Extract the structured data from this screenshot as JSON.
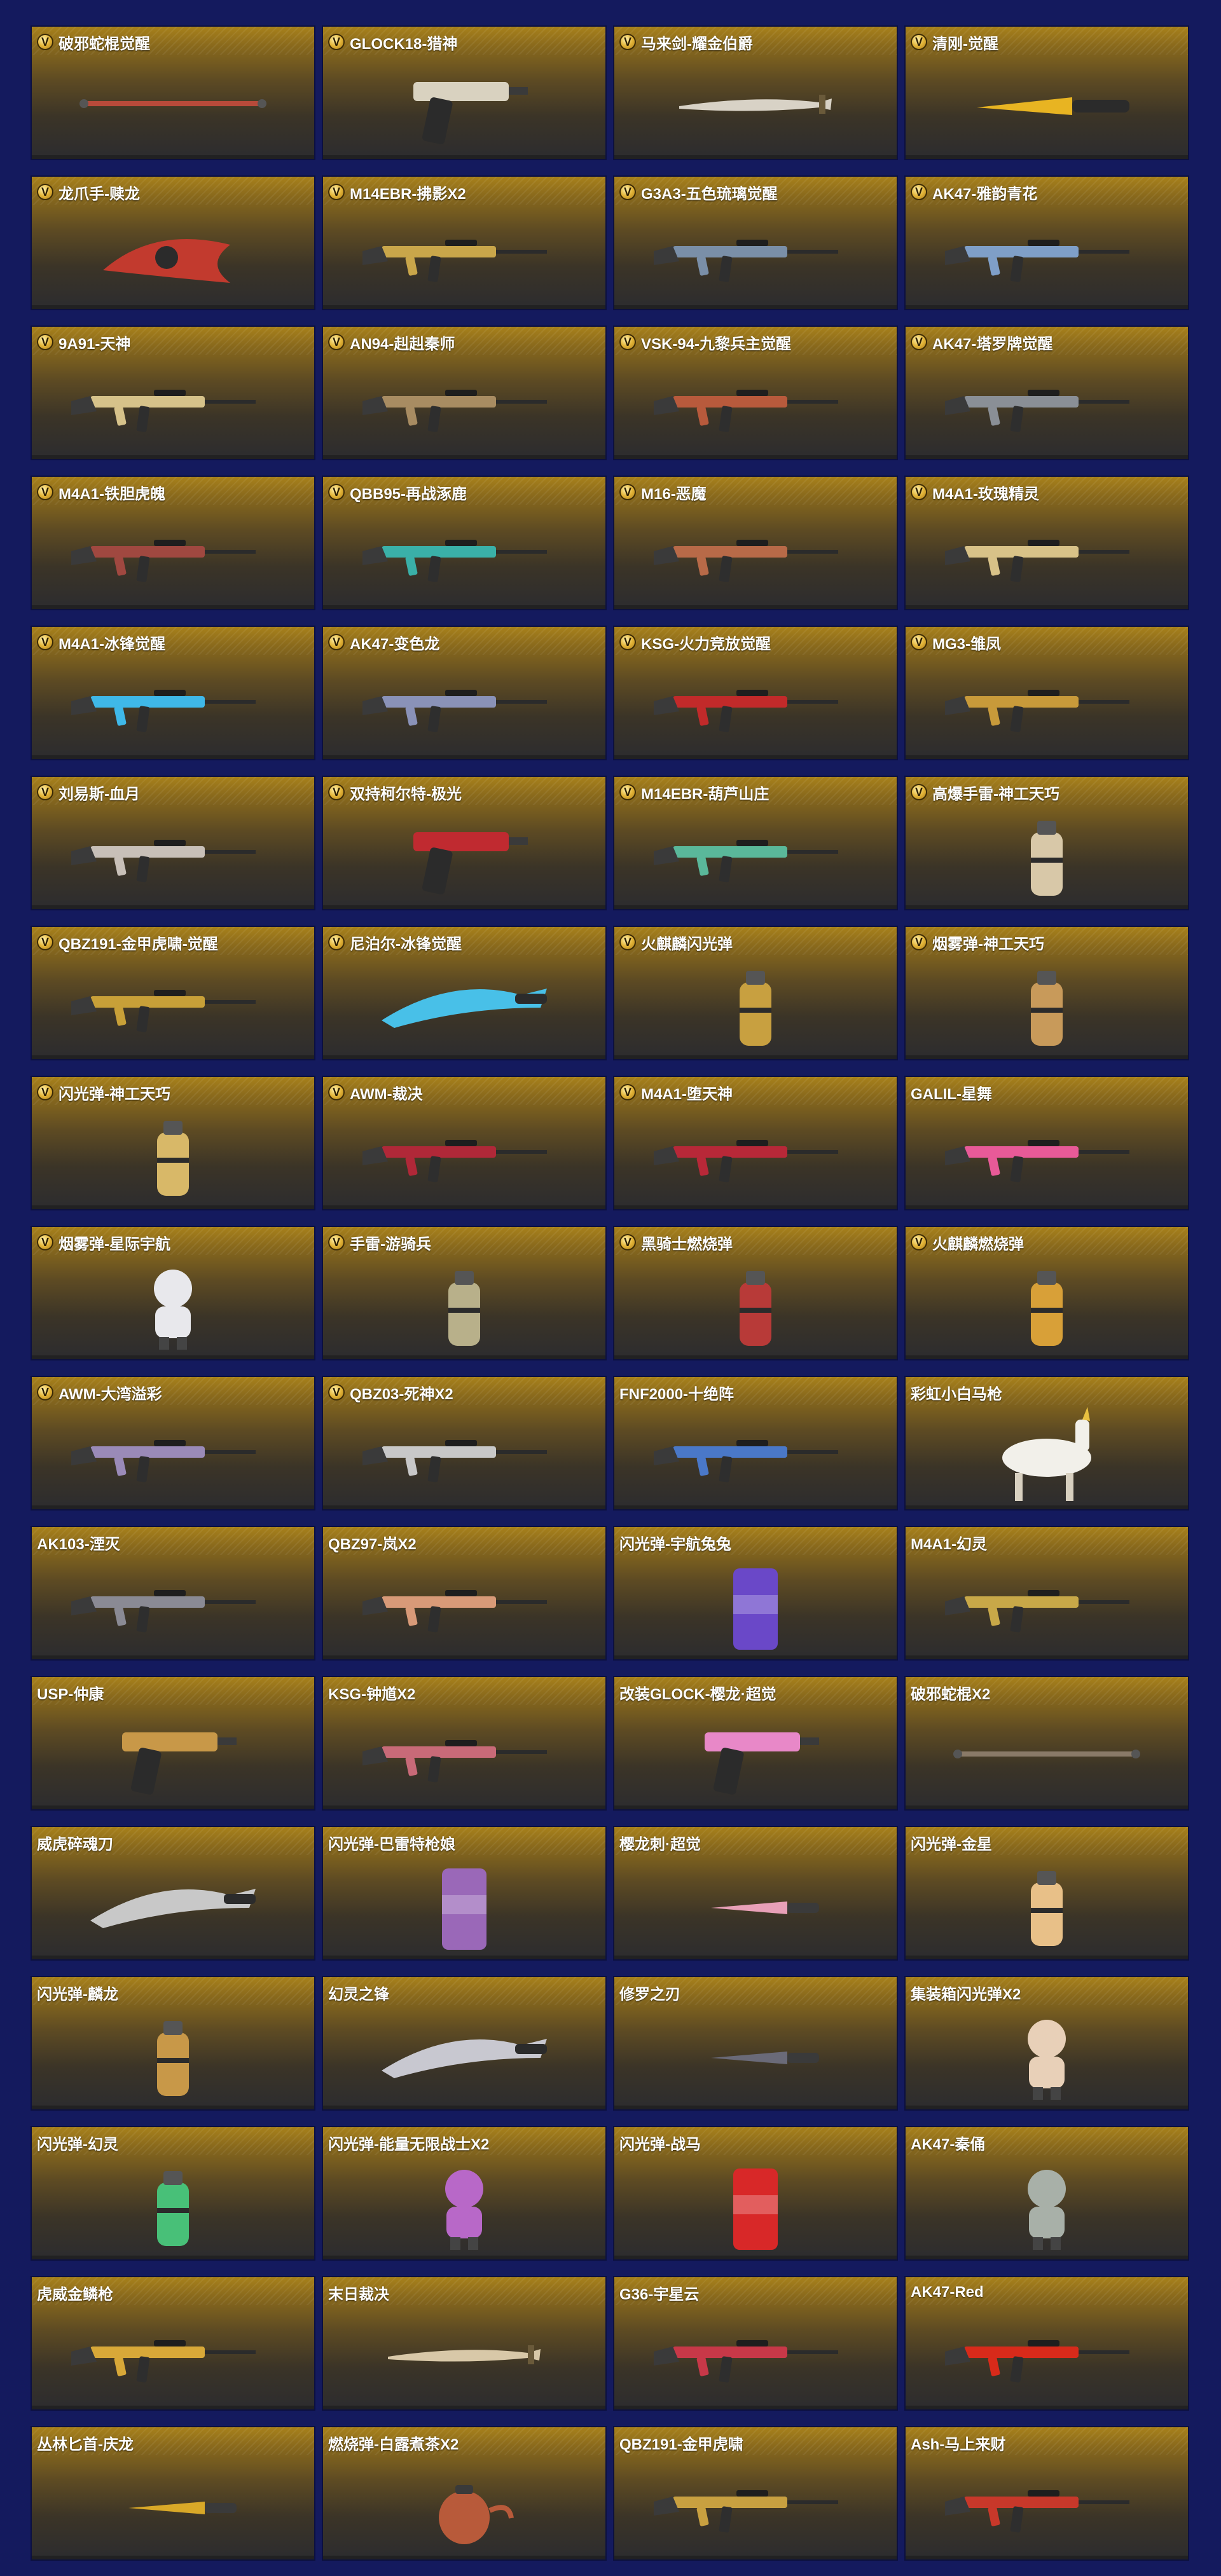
{
  "page": {
    "background_color": "#141a5e",
    "card_gradient_top": "#a8811b",
    "card_gradient_bottom": "#2c2c2f",
    "badge_letter": "V"
  },
  "items": [
    {
      "name": "破邪蛇棍觉醒",
      "badge": true,
      "icon": "staff-icon",
      "accent": "#b84a3a"
    },
    {
      "name": "GLOCK18-猎神",
      "badge": true,
      "icon": "pistol-icon",
      "accent": "#d9d2c0"
    },
    {
      "name": "马来剑-耀金伯爵",
      "badge": true,
      "icon": "sword-icon",
      "accent": "#d8d2c6"
    },
    {
      "name": "清刚-觉醒",
      "badge": true,
      "icon": "knife-icon",
      "accent": "#e8b422"
    },
    {
      "name": "龙爪手-赎龙",
      "badge": true,
      "icon": "claw-icon",
      "accent": "#c23a2e"
    },
    {
      "name": "M14EBR-拂影X2",
      "badge": true,
      "icon": "rifle-icon",
      "accent": "#c9a64a"
    },
    {
      "name": "G3A3-五色琉璃觉醒",
      "badge": true,
      "icon": "rifle-icon",
      "accent": "#7a8fa8"
    },
    {
      "name": "AK47-雅韵青花",
      "badge": true,
      "icon": "rifle-icon",
      "accent": "#7f9fc8"
    },
    {
      "name": "9A91-天神",
      "badge": true,
      "icon": "rifle-icon",
      "accent": "#d6c28a"
    },
    {
      "name": "AN94-赳赳秦师",
      "badge": true,
      "icon": "rifle-icon",
      "accent": "#a88c62"
    },
    {
      "name": "VSK-94-九黎兵主觉醒",
      "badge": true,
      "icon": "rifle-icon",
      "accent": "#b85a3c"
    },
    {
      "name": "AK47-塔罗牌觉醒",
      "badge": true,
      "icon": "rifle-icon",
      "accent": "#8a8f96"
    },
    {
      "name": "M4A1-铁胆虎魄",
      "badge": true,
      "icon": "rifle-icon",
      "accent": "#a04840"
    },
    {
      "name": "QBB95-再战涿鹿",
      "badge": true,
      "icon": "rifle-icon",
      "accent": "#3ab0a8"
    },
    {
      "name": "M16-恶魔",
      "badge": true,
      "icon": "rifle-icon",
      "accent": "#b86a48"
    },
    {
      "name": "M4A1-玫瑰精灵",
      "badge": true,
      "icon": "rifle-icon",
      "accent": "#d8c288"
    },
    {
      "name": "M4A1-冰锋觉醒",
      "badge": true,
      "icon": "rifle-icon",
      "accent": "#3fb8e8"
    },
    {
      "name": "AK47-变色龙",
      "badge": true,
      "icon": "rifle-icon",
      "accent": "#8a92b8"
    },
    {
      "name": "KSG-火力竞放觉醒",
      "badge": true,
      "icon": "shotgun-icon",
      "accent": "#c22a2a"
    },
    {
      "name": "MG3-雏凤",
      "badge": true,
      "icon": "machine-gun-icon",
      "accent": "#c89a3a"
    },
    {
      "name": "刘易斯-血月",
      "badge": true,
      "icon": "machine-gun-icon",
      "accent": "#c8c0b8"
    },
    {
      "name": "双持柯尔特-极光",
      "badge": true,
      "icon": "pistol-icon",
      "accent": "#c02a30"
    },
    {
      "name": "M14EBR-葫芦山庄",
      "badge": true,
      "icon": "rifle-icon",
      "accent": "#5ab89a"
    },
    {
      "name": "高爆手雷-神工天巧",
      "badge": true,
      "icon": "grenade-icon",
      "accent": "#d8c8a8"
    },
    {
      "name": "QBZ191-金甲虎啸-觉醒",
      "badge": true,
      "icon": "rifle-icon",
      "accent": "#c8a038"
    },
    {
      "name": "尼泊尔-冰锋觉醒",
      "badge": true,
      "icon": "blade-icon",
      "accent": "#48c0e8"
    },
    {
      "name": "火麒麟闪光弹",
      "badge": true,
      "icon": "flashbang-icon",
      "accent": "#c8a040"
    },
    {
      "name": "烟雾弹-神工天巧",
      "badge": true,
      "icon": "smoke-grenade-icon",
      "accent": "#c89a5a"
    },
    {
      "name": "闪光弹-神工天巧",
      "badge": true,
      "icon": "flashbang-icon",
      "accent": "#d8b868"
    },
    {
      "name": "AWM-裁决",
      "badge": true,
      "icon": "sniper-icon",
      "accent": "#b02838"
    },
    {
      "name": "M4A1-堕天神",
      "badge": true,
      "icon": "rifle-icon",
      "accent": "#b82838"
    },
    {
      "name": "GALIL-星舞",
      "badge": false,
      "icon": "rifle-icon",
      "accent": "#e85a98"
    },
    {
      "name": "烟雾弹-星际宇航",
      "badge": true,
      "icon": "astronaut-icon",
      "accent": "#e8e8ec"
    },
    {
      "name": "手雷-游骑兵",
      "badge": true,
      "icon": "grenade-icon",
      "accent": "#b8b08a"
    },
    {
      "name": "黑骑士燃烧弹",
      "badge": true,
      "icon": "incendiary-icon",
      "accent": "#b83a38"
    },
    {
      "name": "火麒麟燃烧弹",
      "badge": true,
      "icon": "incendiary-icon",
      "accent": "#d8a038"
    },
    {
      "name": "AWM-大湾溢彩",
      "badge": true,
      "icon": "sniper-icon",
      "accent": "#9a8ab8"
    },
    {
      "name": "QBZ03-死神X2",
      "badge": true,
      "icon": "rifle-icon",
      "accent": "#c8c8c8"
    },
    {
      "name": "FNF2000-十绝阵",
      "badge": false,
      "icon": "rifle-icon",
      "accent": "#4a78c8"
    },
    {
      "name": "彩虹小白马枪",
      "badge": false,
      "icon": "unicorn-gun-icon",
      "accent": "#f2f0ea"
    },
    {
      "name": "AK103-湮灭",
      "badge": false,
      "icon": "rifle-icon",
      "accent": "#8a8a94"
    },
    {
      "name": "QBZ97-岚X2",
      "badge": false,
      "icon": "rifle-icon",
      "accent": "#d89a78"
    },
    {
      "name": "闪光弹-宇航兔兔",
      "badge": false,
      "icon": "canister-icon",
      "accent": "#6a48c8"
    },
    {
      "name": "M4A1-幻灵",
      "badge": false,
      "icon": "rifle-icon",
      "accent": "#c8a848"
    },
    {
      "name": "USP-仲康",
      "badge": false,
      "icon": "pistol-icon",
      "accent": "#c89848"
    },
    {
      "name": "KSG-钟馗X2",
      "badge": false,
      "icon": "shotgun-icon",
      "accent": "#c86a78"
    },
    {
      "name": "改装GLOCK-樱龙·超觉",
      "badge": false,
      "icon": "pistol-icon",
      "accent": "#e888c8"
    },
    {
      "name": "破邪蛇棍X2",
      "badge": false,
      "icon": "staff-icon",
      "accent": "#8a7a68"
    },
    {
      "name": "威虎碎魂刀",
      "badge": false,
      "icon": "blade-icon",
      "accent": "#c8c8c8"
    },
    {
      "name": "闪光弹-巴雷特枪娘",
      "badge": false,
      "icon": "canister-icon",
      "accent": "#9a68b8"
    },
    {
      "name": "樱龙刺·超觉",
      "badge": false,
      "icon": "dagger-icon",
      "accent": "#e8a0b8"
    },
    {
      "name": "闪光弹-金星",
      "badge": false,
      "icon": "grenade-icon",
      "accent": "#e8c088"
    },
    {
      "name": "闪光弹-麟龙",
      "badge": false,
      "icon": "flashbang-icon",
      "accent": "#c89848"
    },
    {
      "name": "幻灵之锋",
      "badge": false,
      "icon": "blade-icon",
      "accent": "#c8c8d0"
    },
    {
      "name": "修罗之刃",
      "badge": false,
      "icon": "dagger-icon",
      "accent": "#6a6a78"
    },
    {
      "name": "集装箱闪光弹X2",
      "badge": false,
      "icon": "doll-icon",
      "accent": "#e8d0b8"
    },
    {
      "name": "闪光弹-幻灵",
      "badge": false,
      "icon": "flashbang-icon",
      "accent": "#48c078"
    },
    {
      "name": "闪光弹-能量无限战士X2",
      "badge": false,
      "icon": "robot-icon",
      "accent": "#b868c8"
    },
    {
      "name": "闪光弹-战马",
      "badge": false,
      "icon": "can-icon",
      "accent": "#d82828"
    },
    {
      "name": "AK47-秦俑",
      "badge": false,
      "icon": "figure-icon",
      "accent": "#a8b0a8"
    },
    {
      "name": "虎威金鳞枪",
      "badge": false,
      "icon": "rifle-icon",
      "accent": "#d8a838"
    },
    {
      "name": "末日裁决",
      "badge": false,
      "icon": "sword-icon",
      "accent": "#d8c8a8"
    },
    {
      "name": "G36-宇星云",
      "badge": false,
      "icon": "rifle-icon",
      "accent": "#c83848"
    },
    {
      "name": "AK47-Red",
      "badge": false,
      "icon": "rifle-icon",
      "accent": "#d82a1a"
    },
    {
      "name": "丛林匕首-庆龙",
      "badge": false,
      "icon": "dagger-icon",
      "accent": "#d8a828"
    },
    {
      "name": "燃烧弹-白露煮茶X2",
      "badge": false,
      "icon": "teapot-icon",
      "accent": "#b85a3a"
    },
    {
      "name": "QBZ191-金甲虎啸",
      "badge": false,
      "icon": "rifle-icon",
      "accent": "#c8a040"
    },
    {
      "name": "Ash-马上来财",
      "badge": false,
      "icon": "rifle-icon",
      "accent": "#c8382a"
    }
  ]
}
